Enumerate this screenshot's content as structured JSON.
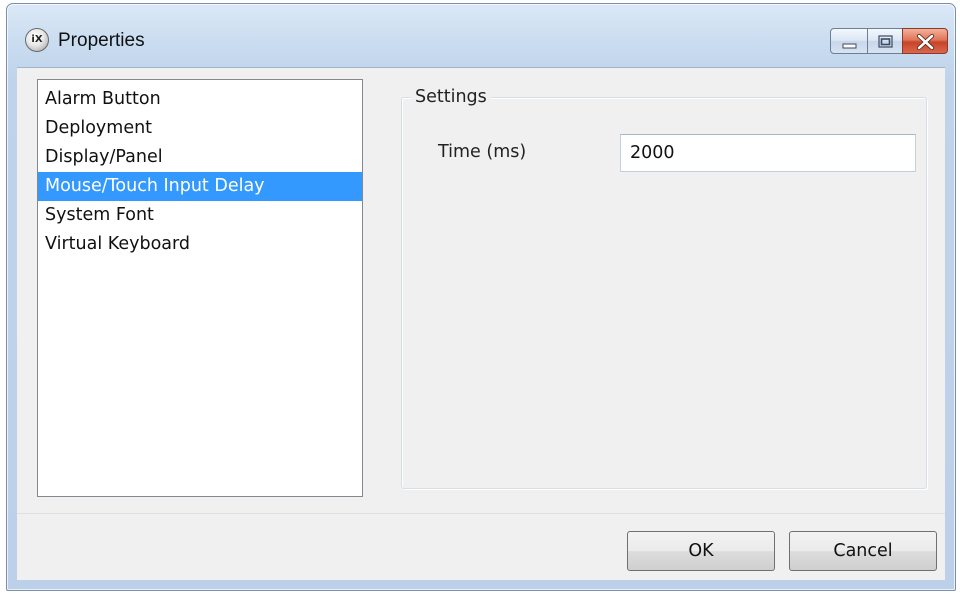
{
  "window": {
    "title": "Properties",
    "app_icon_label": "iX",
    "caption_buttons": [
      "minimize-icon",
      "maximize-icon",
      "close-icon"
    ],
    "accent_selection_color": "#3399ff"
  },
  "sidebar": {
    "items": [
      {
        "label": "Alarm Button",
        "selected": false
      },
      {
        "label": "Deployment",
        "selected": false
      },
      {
        "label": "Display/Panel",
        "selected": false
      },
      {
        "label": "Mouse/Touch Input Delay",
        "selected": true
      },
      {
        "label": "System Font",
        "selected": false
      },
      {
        "label": "Virtual Keyboard",
        "selected": false
      }
    ]
  },
  "settings": {
    "group_title": "Settings",
    "time_label": "Time (ms)",
    "time_value": "2000"
  },
  "footer": {
    "ok_label": "OK",
    "cancel_label": "Cancel"
  }
}
